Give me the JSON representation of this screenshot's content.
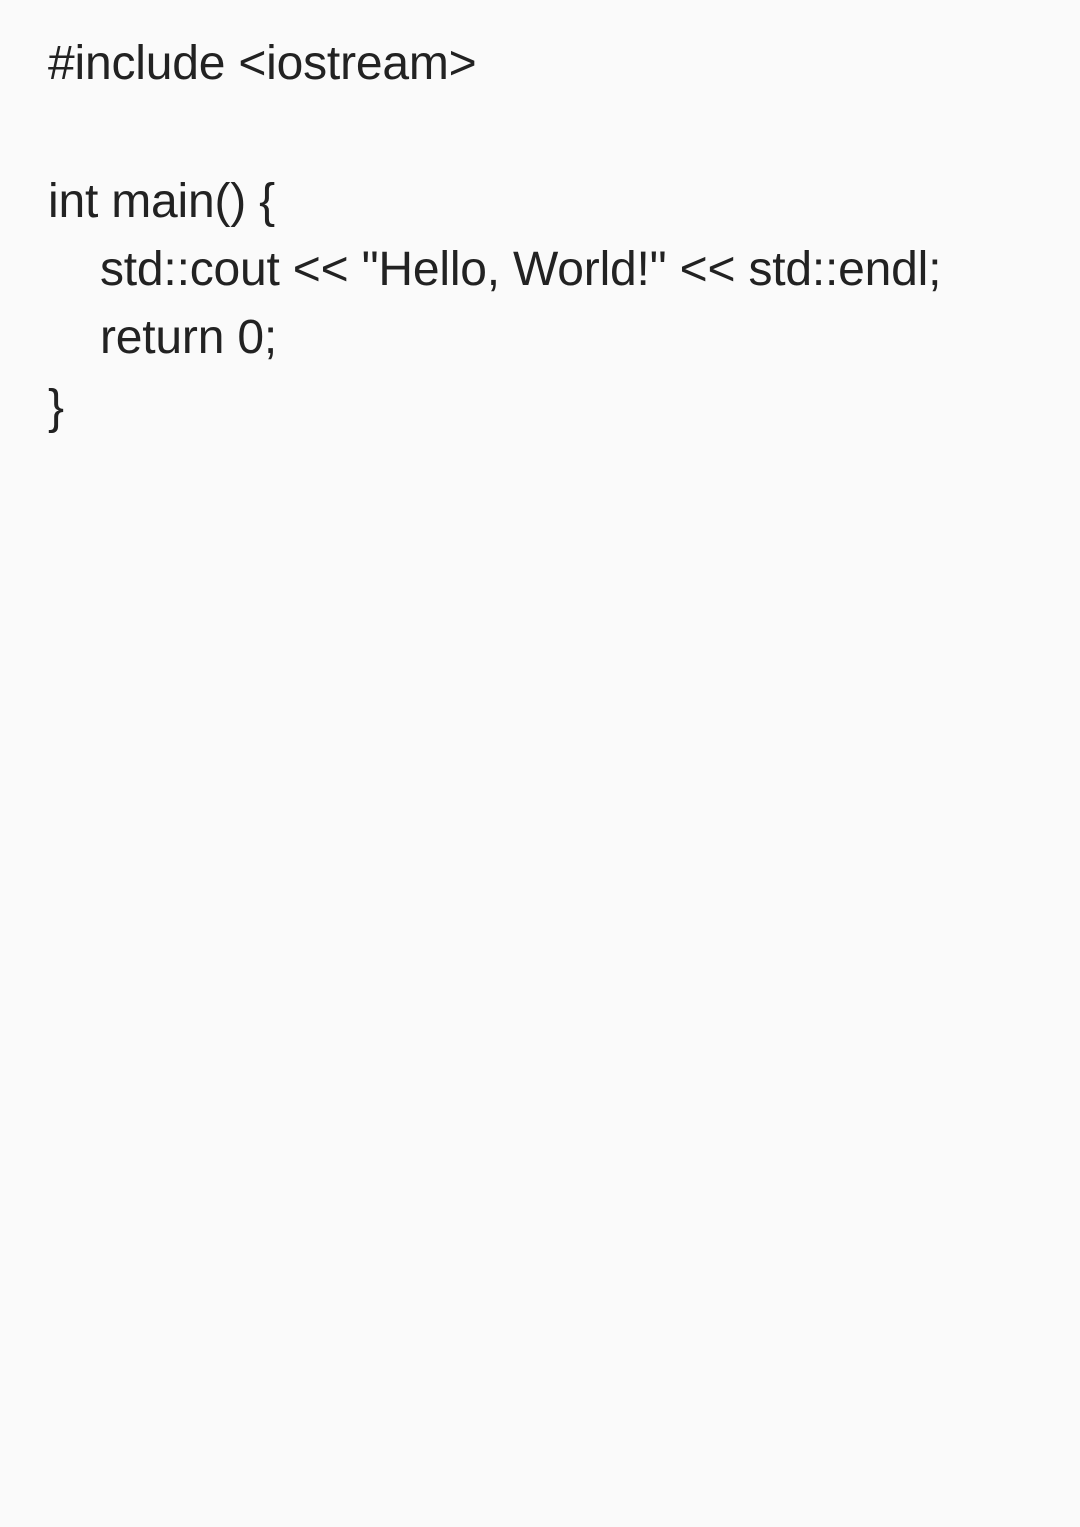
{
  "editor": {
    "lines": [
      "#include <iostream>",
      "",
      "int main() {",
      "std::cout << \"Hello, World!\" << std::endl;",
      "return 0;",
      "}"
    ]
  },
  "colors": {
    "background": "#fafafa",
    "text": "#222222"
  }
}
